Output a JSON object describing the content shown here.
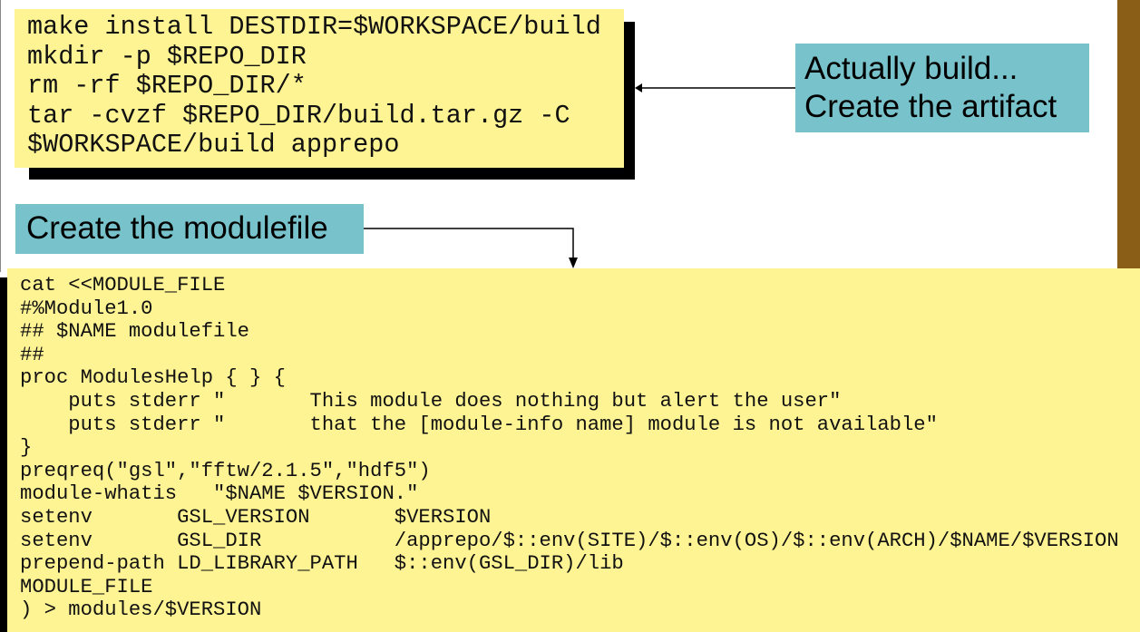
{
  "build_code": {
    "lines": [
      "make install DESTDIR=$WORKSPACE/build",
      "mkdir -p $REPO_DIR",
      "rm -rf $REPO_DIR/*",
      "tar -cvzf $REPO_DIR/build.tar.gz -C",
      "$WORKSPACE/build apprepo"
    ]
  },
  "callout_build": {
    "line1": "Actually build...",
    "line2": "Create the artifact"
  },
  "callout_modulefile": {
    "text": "Create the modulefile"
  },
  "modulefile_code": {
    "lines": [
      "cat <<MODULE_FILE",
      "#%Module1.0",
      "## $NAME modulefile",
      "##",
      "proc ModulesHelp { } {",
      "    puts stderr \"       This module does nothing but alert the user\"",
      "    puts stderr \"       that the [module-info name] module is not available\"",
      "}",
      "preqreq(\"gsl\",\"fftw/2.1.5\",\"hdf5\")",
      "module-whatis   \"$NAME $VERSION.\"",
      "setenv       GSL_VERSION       $VERSION",
      "setenv       GSL_DIR           /apprepo/$::env(SITE)/$::env(OS)/$::env(ARCH)/$NAME/$VERSION",
      "prepend-path LD_LIBRARY_PATH   $::env(GSL_DIR)/lib",
      "MODULE_FILE",
      ") > modules/$VERSION"
    ]
  },
  "colors": {
    "code_box": "#fff494",
    "callout": "#78c3cb",
    "accent_bar": "#8b5e17",
    "shadow": "#000000"
  }
}
